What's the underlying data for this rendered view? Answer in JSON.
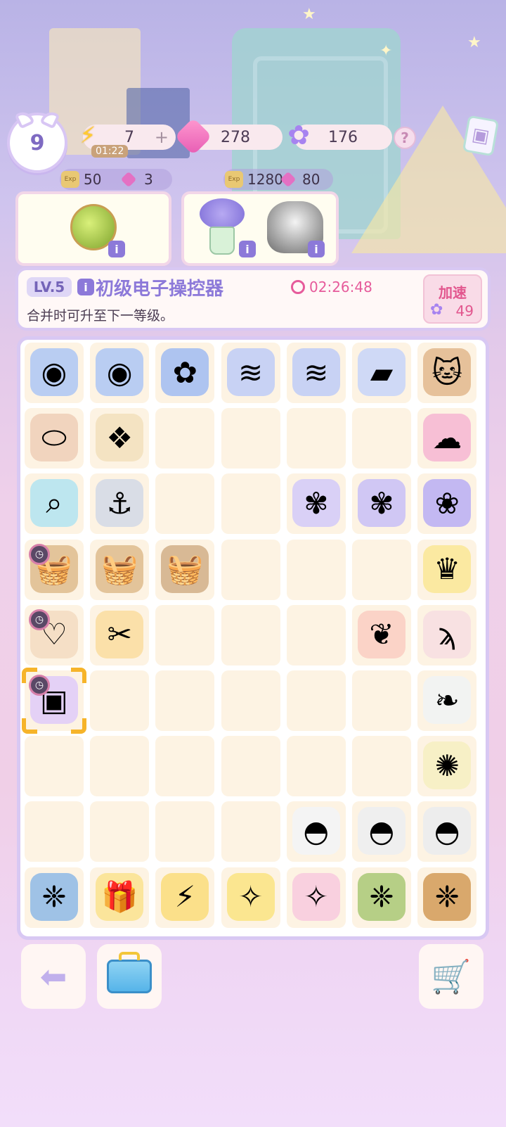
{
  "hud": {
    "level": "9",
    "energy": "7",
    "energy_timer": "01:22",
    "energy_plus": "+",
    "gems": "278",
    "flowers": "176",
    "help": "?"
  },
  "orders": [
    {
      "coins": "50",
      "gems": "3",
      "items": [
        "green-pouch"
      ]
    },
    {
      "coins": "1280",
      "gems": "80",
      "items": [
        "hydrangea-vase",
        "gray-cat-ghost"
      ]
    }
  ],
  "coin_label": "Exp",
  "detail": {
    "level": "LV.5",
    "title": "初级电子操控器",
    "description": "合并时可升至下一等级。",
    "countdown": "02:26:48",
    "speed_up_label": "加速",
    "speed_up_cost": "49"
  },
  "board": {
    "rows": [
      [
        "cat-bed-1",
        "cat-bed-2",
        "cushion",
        "towel-stack",
        "towel-roll",
        "towel-flat",
        "cat-character"
      ],
      [
        "cocoon",
        "net-bag",
        "",
        "",
        "",
        "",
        "pink-bed-sleeper"
      ],
      [
        "magnifier",
        "ribbon-anchor",
        "",
        "",
        "lavender-sprig",
        "lavender-bundle",
        "lavender-bouquet"
      ],
      [
        "flower-basket",
        "basket",
        "bread-basket",
        "",
        "",
        "",
        "yellow-king-blob"
      ],
      [
        "heart-net",
        "scissors",
        "",
        "",
        "",
        "coral",
        "fishing-rod"
      ],
      [
        "electronic-controller",
        "",
        "",
        "",
        "",
        "",
        "white-cat-leaf"
      ],
      [
        "",
        "",
        "",
        "",
        "",
        "",
        "firefly"
      ],
      [
        "",
        "",
        "",
        "",
        "ghost-small",
        "ghost-medium",
        "ghost-cat"
      ],
      [
        "butterfly-box",
        "gift-box",
        "energy-bolts",
        "yellow-gift-chick",
        "pink-gift-chick",
        "green-pouch-box",
        "beetle-box"
      ]
    ],
    "locked": [
      [
        3,
        0
      ],
      [
        4,
        0
      ],
      [
        5,
        0
      ]
    ],
    "selected": [
      5,
      0
    ]
  },
  "icons": {
    "back": "back-arrow-icon",
    "storage": "toolbox-icon",
    "shop": "shopping-cart-icon"
  }
}
